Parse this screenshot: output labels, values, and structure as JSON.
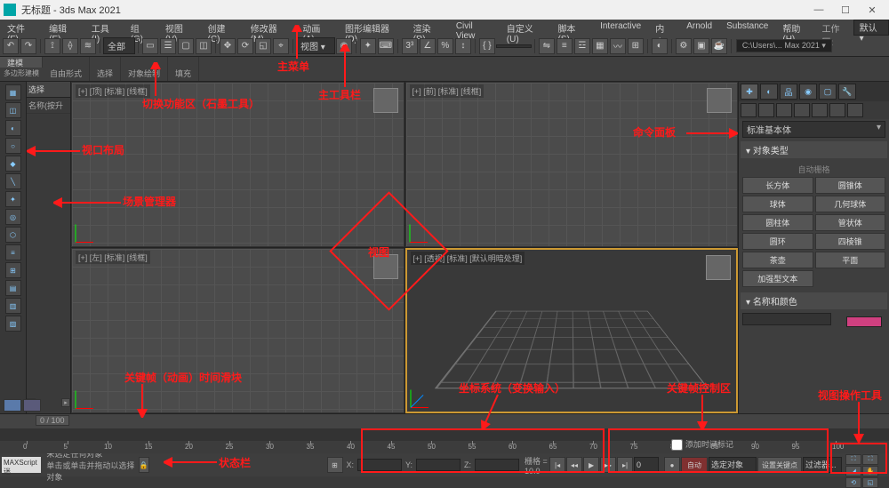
{
  "title": "无标题 - 3ds Max 2021",
  "menu": [
    "文件(F)",
    "编辑(E)",
    "工具(I)",
    "组(G)",
    "视图(V)",
    "创建(C)",
    "修改器(M)",
    "动画(A)",
    "图形编辑器(D)",
    "渲染(R)",
    "Civil View",
    "自定义(U)",
    "脚本(S)",
    "Interactive",
    "内容",
    "Arnold",
    "Substance",
    "帮助(H)"
  ],
  "workspace_label": "工作区:",
  "workspace": "默认",
  "toolbar_path": "C:\\Users\\... Max 2021 ▾",
  "toolbar_all": "全部",
  "ribbon": {
    "tab": "建模",
    "subtab": "多边形建模",
    "panels": [
      "自由形式",
      "选择",
      "对象绘制",
      "填充"
    ]
  },
  "scene_explorer": {
    "header": "选择",
    "column": "名称(按升"
  },
  "viewports": {
    "tl": "[+] [顶] [标准] [线框]",
    "tr": "[+] [前] [标准] [线框]",
    "bl": "[+] [左] [标准] [线框]",
    "br": "[+] [透视] [标准] [默认明暗处理]"
  },
  "cmd": {
    "dropdown": "标准基本体",
    "rollout1": "对象类型",
    "autogrid": "自动栅格",
    "buttons": [
      "长方体",
      "圆锥体",
      "球体",
      "几何球体",
      "圆柱体",
      "管状体",
      "圆环",
      "四棱锥",
      "茶壶",
      "平面",
      "加强型文本",
      ""
    ],
    "rollout2": "名称和颜色"
  },
  "timeline": {
    "slider": "0 / 100",
    "start": 0,
    "end": 100,
    "step": 5
  },
  "status": {
    "line1": "未选定任何对象",
    "line2": "单击或单击并拖动以选择对象",
    "maxscript": "MAXScript 迷",
    "x_lbl": "X:",
    "y_lbl": "Y:",
    "z_lbl": "Z:",
    "grid": "栅格 = 10.0",
    "addtime": "添加时间标记",
    "auto_btn": "自动",
    "set_key": "设置关键点",
    "filter_lbl": "过滤器...",
    "selected_obj": "选定对象",
    "frame_field": "0"
  },
  "annotations": {
    "ribbon_switch": "切换功能区（石墨工具）",
    "main_menu": "主菜单",
    "main_toolbar": "主工具栏",
    "cmd_panel": "命令面板",
    "viewport_layout": "视口布局",
    "scene_manager": "场景管理器",
    "viewport": "视图",
    "keyframe_slider": "关键帧（动画）时间滑块",
    "coord_system": "坐标系统（变换输入）",
    "keyframe_ctrl": "关键帧控制区",
    "viewport_nav": "视图操作工具",
    "status_bar": "状态栏"
  }
}
